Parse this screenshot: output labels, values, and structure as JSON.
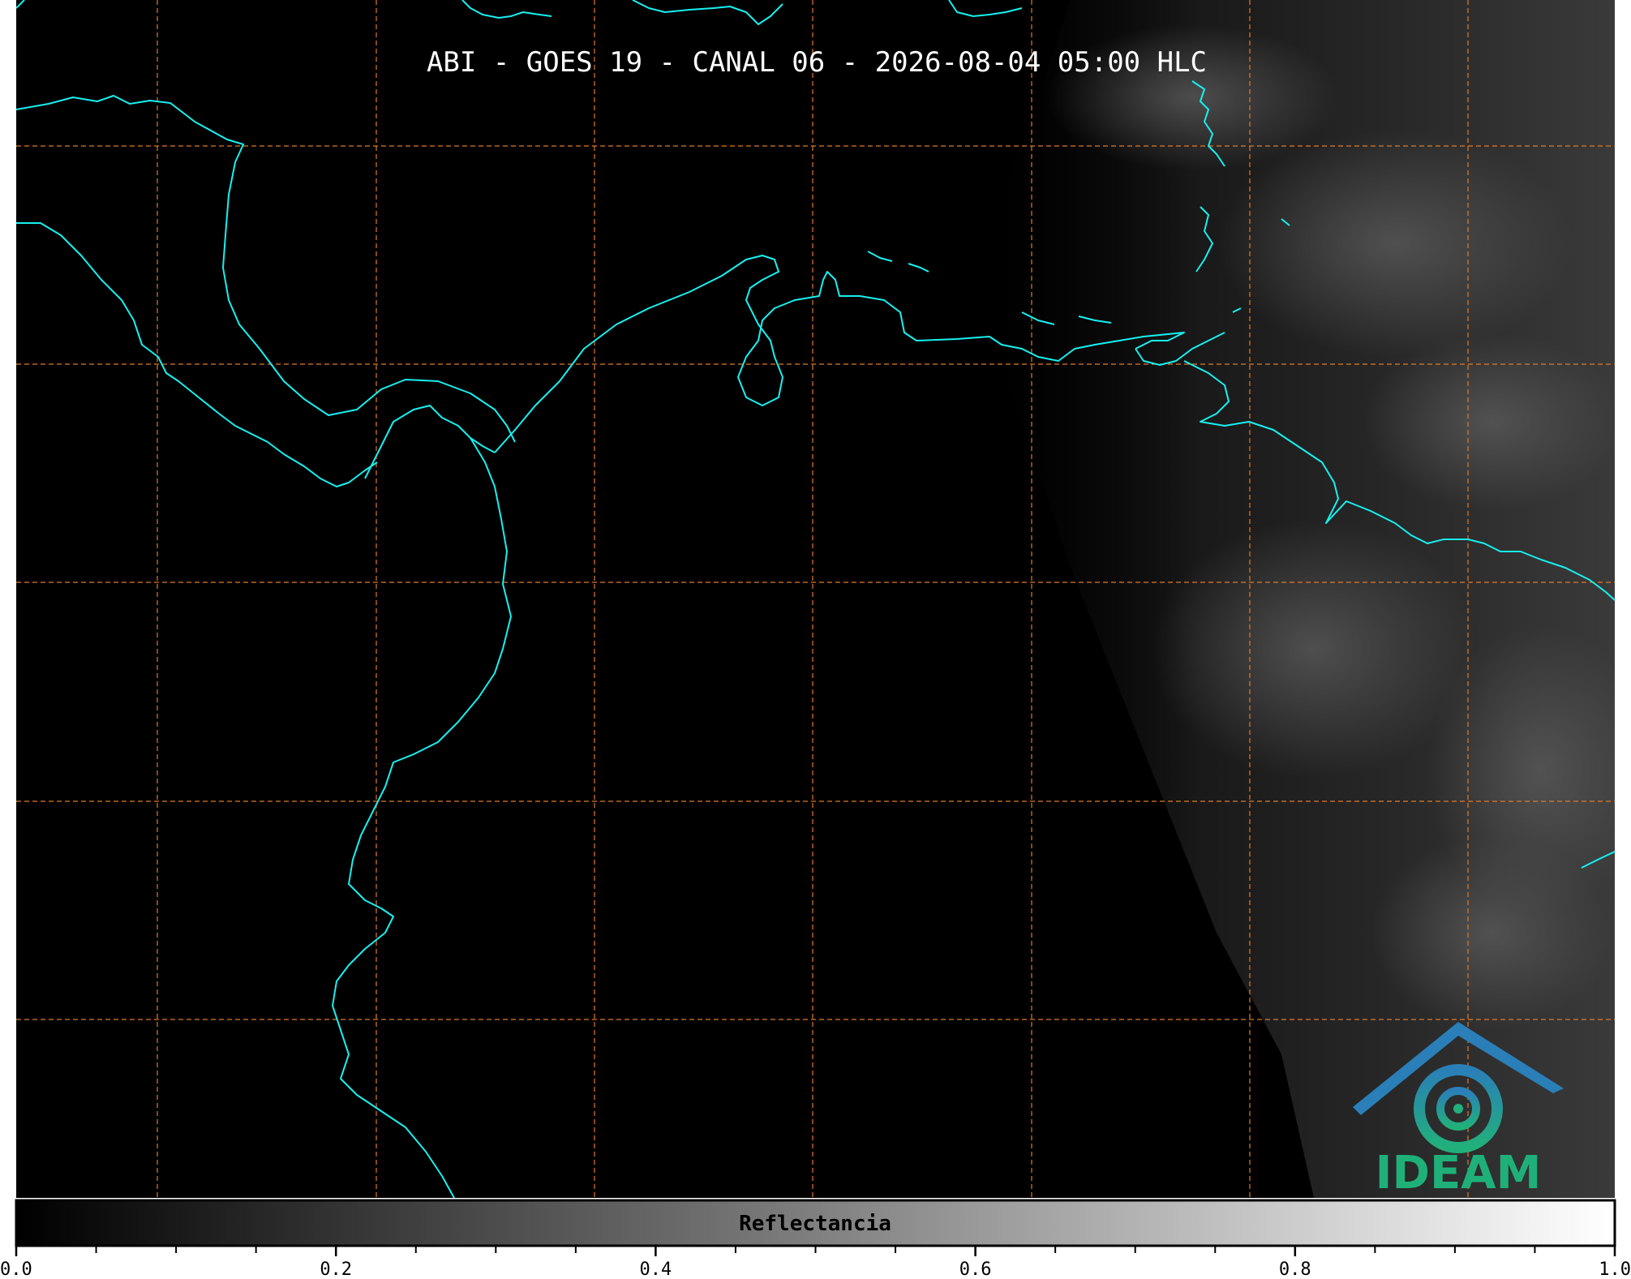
{
  "map": {
    "title": "ABI - GOES 19 - CANAL 06 - 2026-08-04 05:00 HLC",
    "coastline_color": "#18f0f0",
    "grid_color": "#e07a28",
    "background_color": "#000000"
  },
  "logo": {
    "text": "IDEAM",
    "text_color": "#1fb07a",
    "roof_color": "#2a7fb8"
  },
  "colorbar": {
    "label": "Reflectancia",
    "colormap": "greys",
    "range": [
      0.0,
      1.0
    ],
    "tick_labels": [
      "0.0",
      "0.2",
      "0.4",
      "0.6",
      "0.8",
      "1.0"
    ],
    "tick_values": [
      0.0,
      0.2,
      0.4,
      0.6,
      0.8,
      1.0
    ]
  }
}
